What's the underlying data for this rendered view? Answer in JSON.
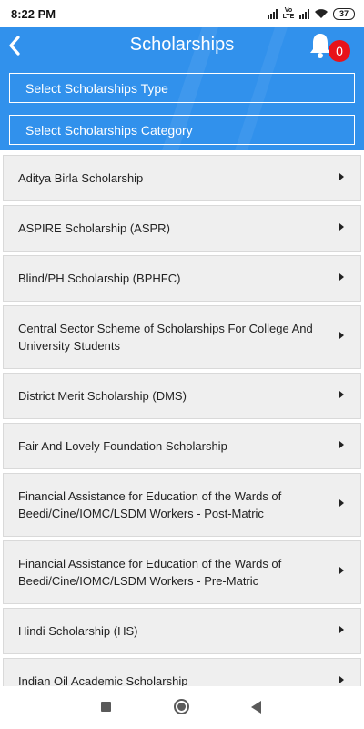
{
  "status_bar": {
    "time": "8:22 PM",
    "network_label": "Vo LTE",
    "battery": "37"
  },
  "header": {
    "title": "Scholarships",
    "back_icon": "chevron-left-icon",
    "notification_icon": "bell-icon",
    "notification_count": "0",
    "select_type_label": "Select Scholarships Type",
    "select_category_label": "Select Scholarships Category",
    "color": "#3191ec",
    "badge_color": "#e8121a"
  },
  "scholarships": [
    "Aditya Birla Scholarship",
    "ASPIRE Scholarship (ASPR)",
    "Blind/PH Scholarship (BPHFC)",
    "Central Sector Scheme of Scholarships For College And University Students",
    "District Merit Scholarship (DMS)",
    "Fair And Lovely Foundation Scholarship",
    "Financial Assistance for Education of the Wards of Beedi/Cine/IOMC/LSDM Workers - Post-Matric",
    "Financial Assistance for Education of the Wards of Beedi/Cine/IOMC/LSDM Workers - Pre-Matric",
    "Hindi Scholarship (HS)",
    "Indian Oil Academic Scholarship"
  ],
  "nav_bar": {
    "recents_icon": "square-icon",
    "home_icon": "circle-icon",
    "back_icon": "triangle-back-icon"
  }
}
